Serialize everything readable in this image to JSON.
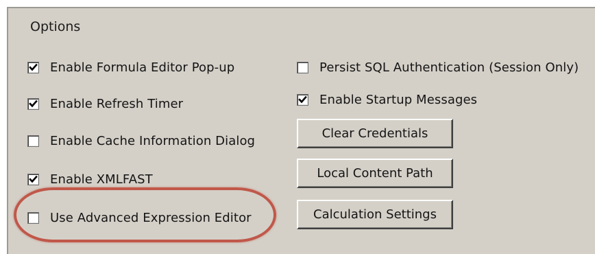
{
  "options": {
    "title": "Options",
    "left_column": [
      {
        "label": "Enable Formula Editor Pop-up",
        "checked": true
      },
      {
        "label": "Enable Refresh Timer",
        "checked": true
      },
      {
        "label": "Enable Cache Information Dialog",
        "checked": false
      },
      {
        "label": "Enable XMLFAST",
        "checked": true
      },
      {
        "label": "Use Advanced Expression Editor",
        "checked": false
      }
    ],
    "right_column": [
      {
        "label": "Persist SQL Authentication (Session Only)",
        "checked": false
      },
      {
        "label": "Enable Startup Messages",
        "checked": true
      }
    ],
    "buttons": {
      "clear_credentials": "Clear Credentials",
      "local_content_path": "Local Content Path",
      "calculation_settings": "Calculation Settings"
    }
  },
  "icons": {
    "checkmark": "checkmark-icon"
  },
  "colors": {
    "panel_background": "#d4d0c8",
    "highlight_ring": "#c0584a"
  }
}
